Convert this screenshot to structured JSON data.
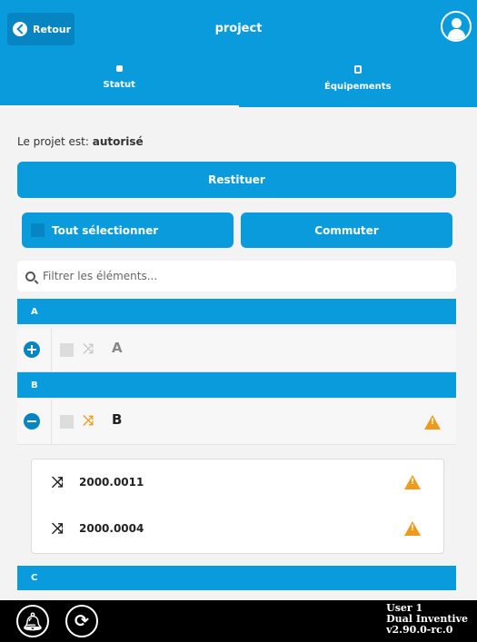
{
  "header": {
    "back_label": "Retour",
    "title": "project"
  },
  "tabs": [
    {
      "label": "Statut",
      "active": true
    },
    {
      "label": "Équipements",
      "active": false
    }
  ],
  "status": {
    "prefix": "Le projet est:",
    "value": "autorisé"
  },
  "actions": {
    "restore_label": "Restituer",
    "select_all_label": "Tout sélectionner",
    "switch_label": "Commuter"
  },
  "filter": {
    "placeholder": "Filtrer les éléments..."
  },
  "groups": [
    {
      "header": "A",
      "name": "A",
      "expanded": false,
      "warning": false
    },
    {
      "header": "B",
      "name": "B",
      "expanded": true,
      "warning": true,
      "items": [
        {
          "label": "2000.0011",
          "warning": true
        },
        {
          "label": "2000.0004",
          "warning": true
        }
      ]
    },
    {
      "header": "C"
    }
  ],
  "footer": {
    "user": "User 1",
    "company": "Dual Inventive",
    "version": "v2.90.0-rc.0"
  },
  "colors": {
    "primary": "#0a9bdd",
    "primary_dark": "#0785c2",
    "warning": "#ee9a1a",
    "footer_bg": "#000000"
  }
}
